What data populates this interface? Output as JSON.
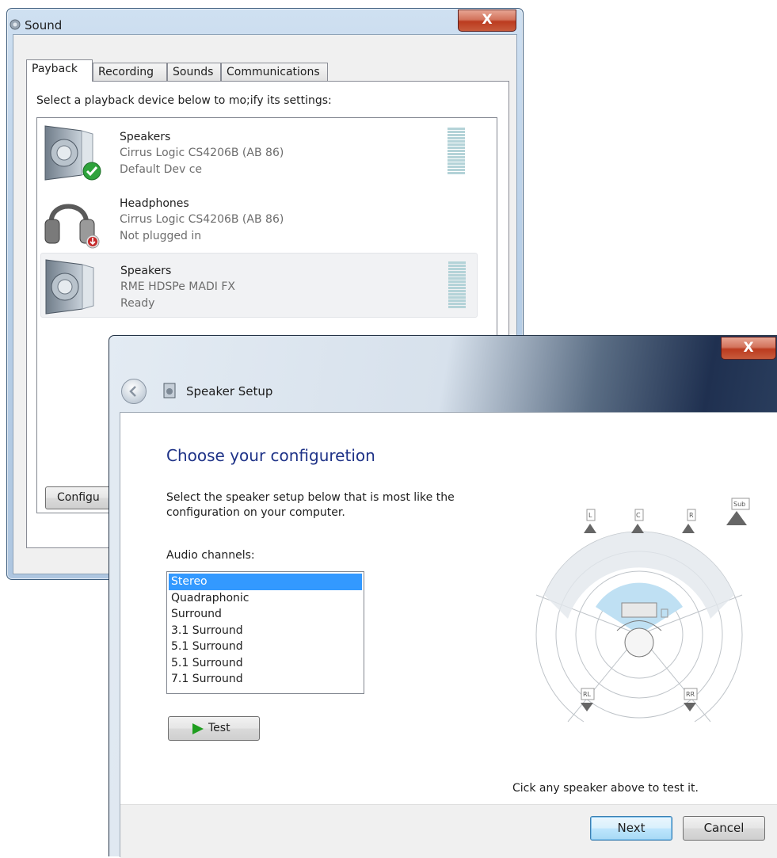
{
  "sound_window": {
    "title": "Sound",
    "close_label": "X",
    "tabs": [
      {
        "label": "Payback"
      },
      {
        "label": "Recording"
      },
      {
        "label": "Sounds"
      },
      {
        "label": "Communications"
      }
    ],
    "description": "Select a playback device below to mo;ify its settings:",
    "devices": [
      {
        "name": "Speakers",
        "driver": "Cirrus Logic CS4206B (AB 86)",
        "status": "Default Dev ce",
        "icon": "speaker-icon",
        "badge": "default-check-icon",
        "level_meter": true
      },
      {
        "name": "Headphones",
        "driver": "Cirrus Logic CS4206B (AB 86)",
        "status": "Not plugged in",
        "icon": "headphones-icon",
        "badge": "unplugged-icon",
        "level_meter": false
      },
      {
        "name": "Speakers",
        "driver": "RME HDSPe MADI FX",
        "status": "Ready",
        "icon": "speaker-icon",
        "badge": "",
        "level_meter": true
      }
    ],
    "configure_label": "Configu"
  },
  "setup_window": {
    "title": "Speaker Setup",
    "close_label": "X",
    "heading": "Choose your configuretion",
    "instruction": "Select the speaker setup below that is most like the configuration on your computer.",
    "channels_label": "Audio channels:",
    "channels": [
      "Stereo",
      "Quadraphonic",
      "Surround",
      "3.1 Surround",
      "5.1 Surround",
      "5.1 Surround",
      "7.1 Surround"
    ],
    "selected_channel": "Stereo",
    "test_label": "Test",
    "speaker_labels": {
      "front_left": "L",
      "center": "C",
      "front_right": "R",
      "subwoofer": "Sub",
      "rear_left": "RL",
      "rear_right": "RR"
    },
    "hint": "Cick any speaker above to test it.",
    "next_label": "Next",
    "cancel_label": "Cancel"
  },
  "colors": {
    "heading": "#1e3287",
    "selection": "#3399ff",
    "level_meter": "#b4d3d8",
    "close_button": "#c85b3c"
  }
}
